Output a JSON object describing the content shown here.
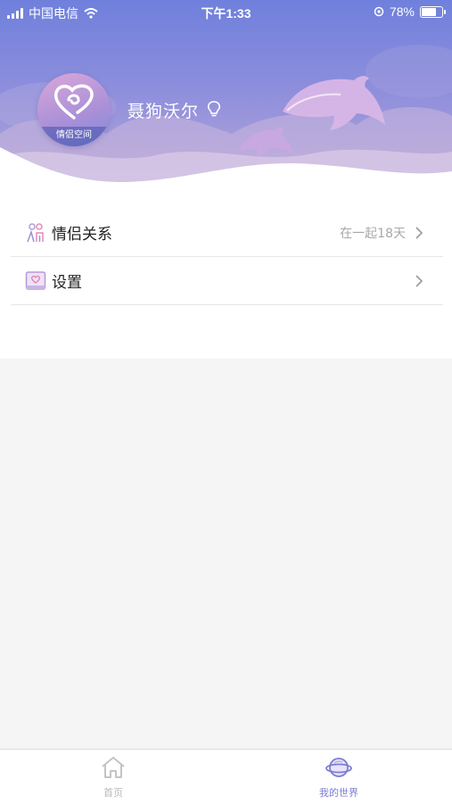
{
  "status_bar": {
    "carrier": "中国电信",
    "time": "下午1:33",
    "battery_percent": "78%",
    "battery_level": 0.78
  },
  "profile": {
    "avatar_label": "情侣空间",
    "username": "聂狗沃尔",
    "icons": [
      "bulb-icon",
      "dolphin-illustration",
      "heart-logo-icon"
    ]
  },
  "menu": {
    "items": [
      {
        "label": "情侣关系",
        "value": "在一起18天",
        "icon": "couple-icon"
      },
      {
        "label": "设置",
        "value": "",
        "icon": "settings-heart-icon"
      }
    ]
  },
  "tabbar": {
    "tabs": [
      {
        "label": "首页",
        "icon": "home-icon",
        "active": false
      },
      {
        "label": "我的世界",
        "icon": "planet-icon",
        "active": true
      }
    ]
  },
  "colors": {
    "header_top": "#6f80dc",
    "header_bottom": "#c1acd8",
    "accent": "#7d7ed0",
    "inactive": "#b9b9b9"
  }
}
